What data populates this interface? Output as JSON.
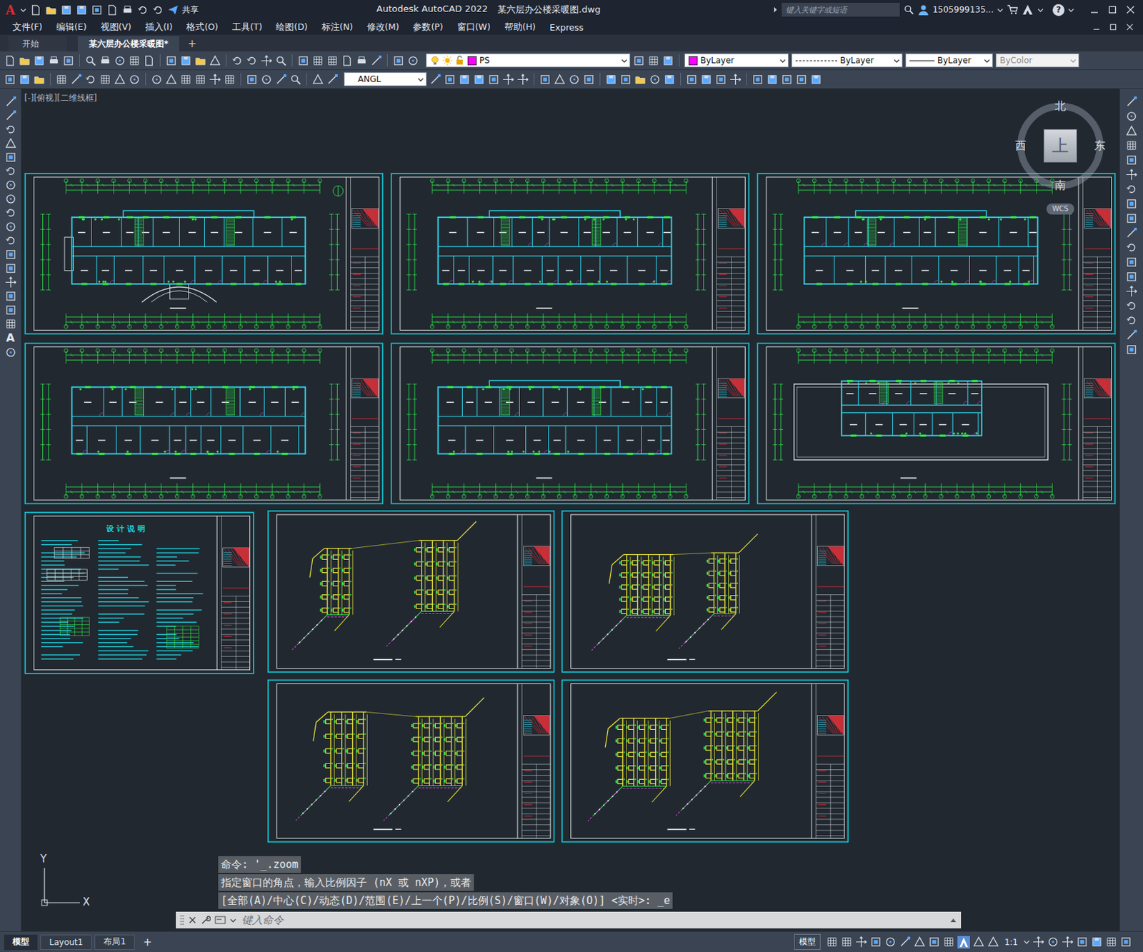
{
  "window": {
    "title": "Autodesk AutoCAD 2022",
    "document": "某六层办公楼采暖图.dwg"
  },
  "app_menu": {
    "logo": "A"
  },
  "quick_access": {
    "share": "共享"
  },
  "search": {
    "placeholder": "键入关键字或短语"
  },
  "user": {
    "name": "1505999135..."
  },
  "help": "?",
  "menus": [
    "文件(F)",
    "编辑(E)",
    "视图(V)",
    "插入(I)",
    "格式(O)",
    "工具(T)",
    "绘图(D)",
    "标注(N)",
    "修改(M)",
    "参数(P)",
    "窗口(W)",
    "帮助(H)",
    "Express"
  ],
  "file_tabs": [
    {
      "label": "开始",
      "selected": false
    },
    {
      "label": "某六层办公楼采暖图*",
      "selected": true
    }
  ],
  "new_tab": "+",
  "layer": {
    "name": "PS",
    "color": "#ff00ff"
  },
  "properties": {
    "color": {
      "label": "ByLayer",
      "color": "#ff00ff"
    },
    "linetype": "ByLayer",
    "lineweight": "ByLayer",
    "plotstyle": {
      "label": "ByColor",
      "disabled": true
    }
  },
  "dimstyle": "ANGL",
  "left_tools": {
    "text_tool": "A"
  },
  "viewport": {
    "label": "[-][俯视][二维线框]"
  },
  "viewcube": {
    "north": "北",
    "south": "南",
    "east": "东",
    "west": "西",
    "face": "上",
    "ucs": "WCS"
  },
  "ucs_icon": {
    "x": "X",
    "y": "Y"
  },
  "sheets": [
    {
      "kind": "groundplan"
    },
    {
      "kind": "floorplan"
    },
    {
      "kind": "floorplan"
    },
    {
      "kind": "floorplan"
    },
    {
      "kind": "floorplan"
    },
    {
      "kind": "roofplan"
    },
    {
      "kind": "notes",
      "heading": "设 计 说 明"
    },
    {
      "kind": "isometric"
    },
    {
      "kind": "isometric"
    },
    {
      "kind": "isometric"
    },
    {
      "kind": "isometric"
    }
  ],
  "command": {
    "history": [
      "命令: '_.zoom",
      "指定窗口的角点，输入比例因子 (nX 或 nXP)，或者",
      "[全部(A)/中心(C)/动态(D)/范围(E)/上一个(P)/比例(S)/窗口(W)/对象(O)] <实时>: _e"
    ],
    "placeholder": "键入命令"
  },
  "layout_tabs": [
    {
      "label": "模型",
      "selected": true
    },
    {
      "label": "Layout1",
      "selected": false
    },
    {
      "label": "布局1",
      "selected": false
    }
  ],
  "add_layout": "+",
  "status_bar": {
    "mode": "模型",
    "scale": "1:1"
  }
}
